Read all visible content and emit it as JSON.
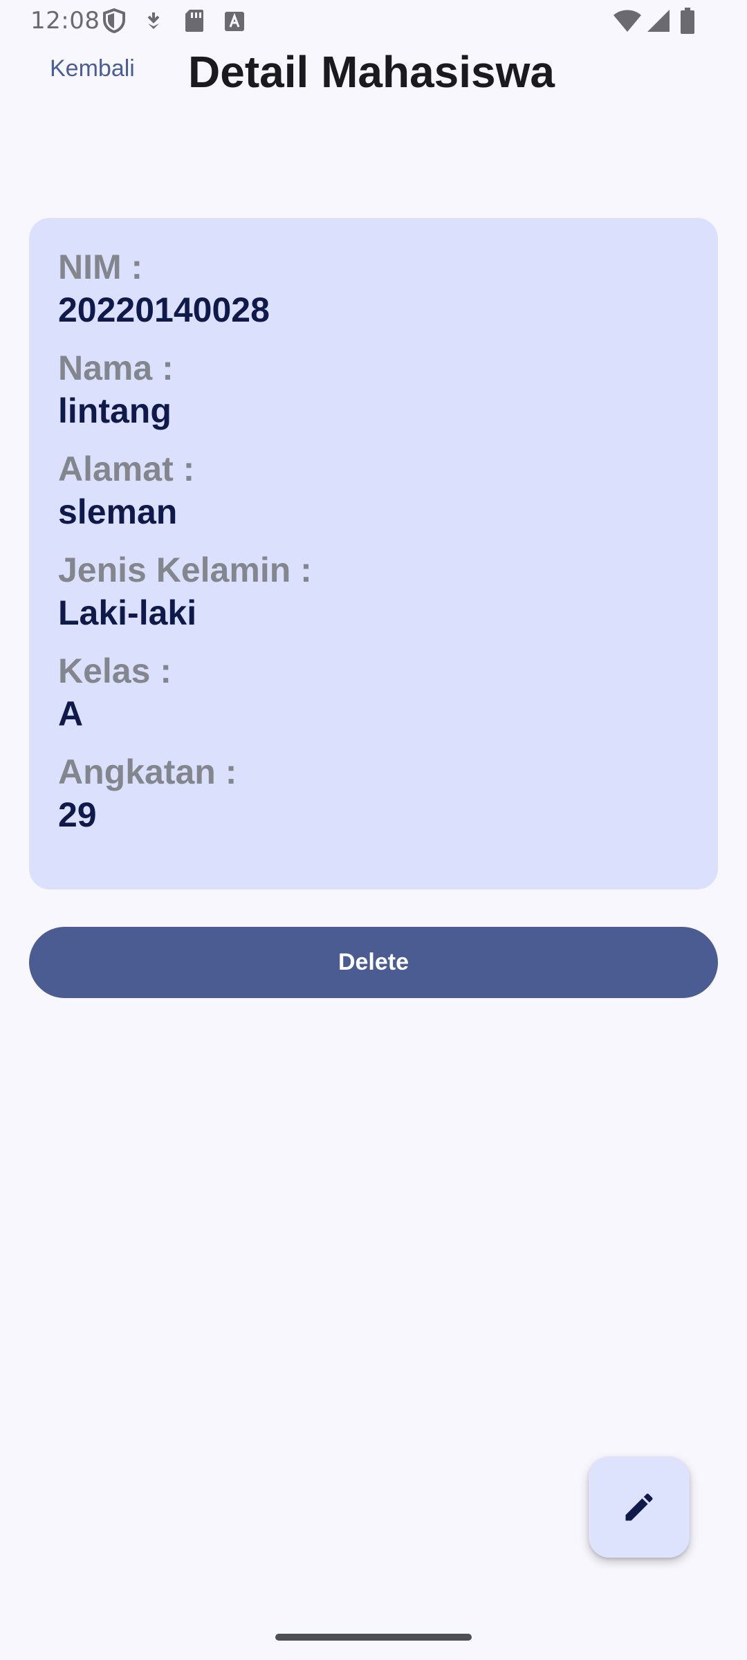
{
  "status_bar": {
    "time": "12:08"
  },
  "header": {
    "back_label": "Kembali",
    "title": "Detail Mahasiswa"
  },
  "card": {
    "fields": [
      {
        "label": "NIM :",
        "value": "20220140028"
      },
      {
        "label": "Nama :",
        "value": "lintang"
      },
      {
        "label": "Alamat :",
        "value": "sleman"
      },
      {
        "label": "Jenis Kelamin :",
        "value": "Laki-laki"
      },
      {
        "label": "Kelas :",
        "value": "A"
      },
      {
        "label": "Angkatan :",
        "value": "29"
      }
    ]
  },
  "actions": {
    "delete_label": "Delete",
    "fab_icon": "edit-pencil-icon"
  },
  "colors": {
    "background": "#f8f7fd",
    "card": "#dbe1fd",
    "primary": "#4a5c92",
    "label": "#84868d",
    "value": "#0f1a4a"
  }
}
